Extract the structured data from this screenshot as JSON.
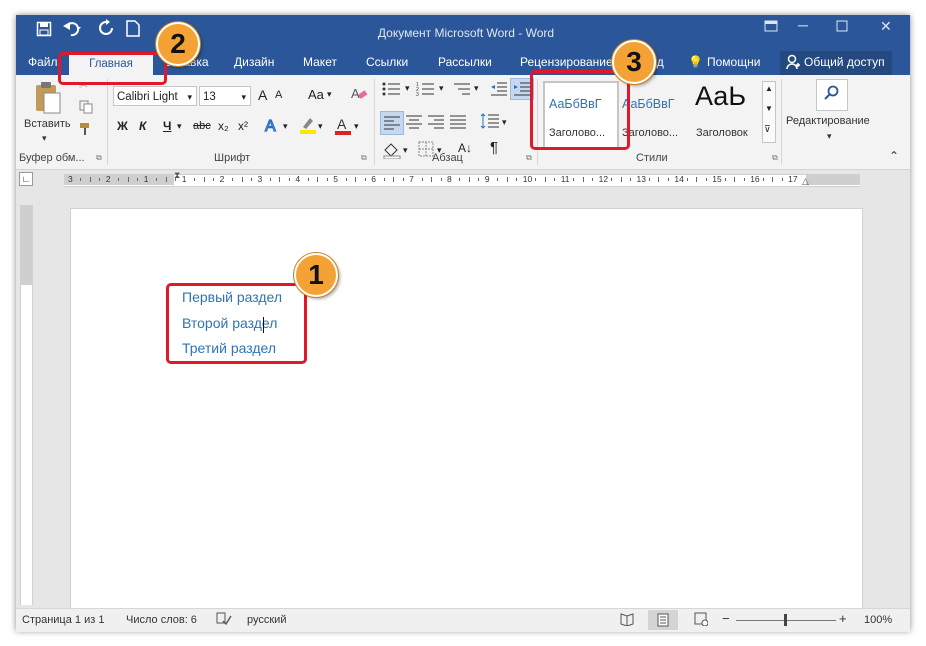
{
  "window": {
    "title": "Документ Microsoft Word  -  Word"
  },
  "quick_access": {
    "save_icon": "save-icon",
    "undo_icon": "undo-icon",
    "redo_icon": "redo-icon",
    "new_icon": "new-doc-icon"
  },
  "tabs": {
    "file": "Файл",
    "home": "Главная",
    "insert": "Вставка",
    "design": "Дизайн",
    "layout": "Макет",
    "references": "Ссылки",
    "mailings": "Рассылки",
    "review": "Рецензирование",
    "view": "Вид",
    "help": "Помощни",
    "share": "Общий доступ"
  },
  "ribbon": {
    "clipboard": {
      "paste": "Вставить",
      "label": "Буфер обм..."
    },
    "font": {
      "name": "Calibri Light",
      "size": "13",
      "grow": "A",
      "shrink": "A",
      "case": "Aa",
      "bold": "Ж",
      "italic": "К",
      "underline": "Ч",
      "strike": "abc",
      "sub": "x₂",
      "sup": "x²",
      "label": "Шрифт"
    },
    "paragraph": {
      "sort": "А↓",
      "pilcrow": "¶",
      "label": "Абзац"
    },
    "styles": {
      "items": [
        {
          "preview": "АаБбВвГ",
          "name": "Заголово..."
        },
        {
          "preview": "АаБбВвГ",
          "name": "Заголово..."
        },
        {
          "preview": "АаЬ",
          "name": "Заголовок"
        }
      ],
      "label": "Стили"
    },
    "editing": {
      "label": "Редактирование"
    }
  },
  "ruler": {
    "numbers": [
      "3",
      "2",
      "1",
      "1",
      "2",
      "3",
      "4",
      "5",
      "6",
      "7",
      "8",
      "9",
      "10",
      "11",
      "12",
      "13",
      "14",
      "15",
      "16",
      "17"
    ]
  },
  "document": {
    "lines": [
      "Первый раздел",
      "Второй раздел",
      "Третий раздел"
    ]
  },
  "status": {
    "page": "Страница 1 из 1",
    "words": "Число слов: 6",
    "language": "русский",
    "zoom": "100%"
  },
  "callouts": [
    "1",
    "2",
    "3"
  ],
  "colors": {
    "accent": "#2b579a",
    "heading": "#2e74b5",
    "callout_border": "#e0182a",
    "badge": "#f4a235"
  }
}
